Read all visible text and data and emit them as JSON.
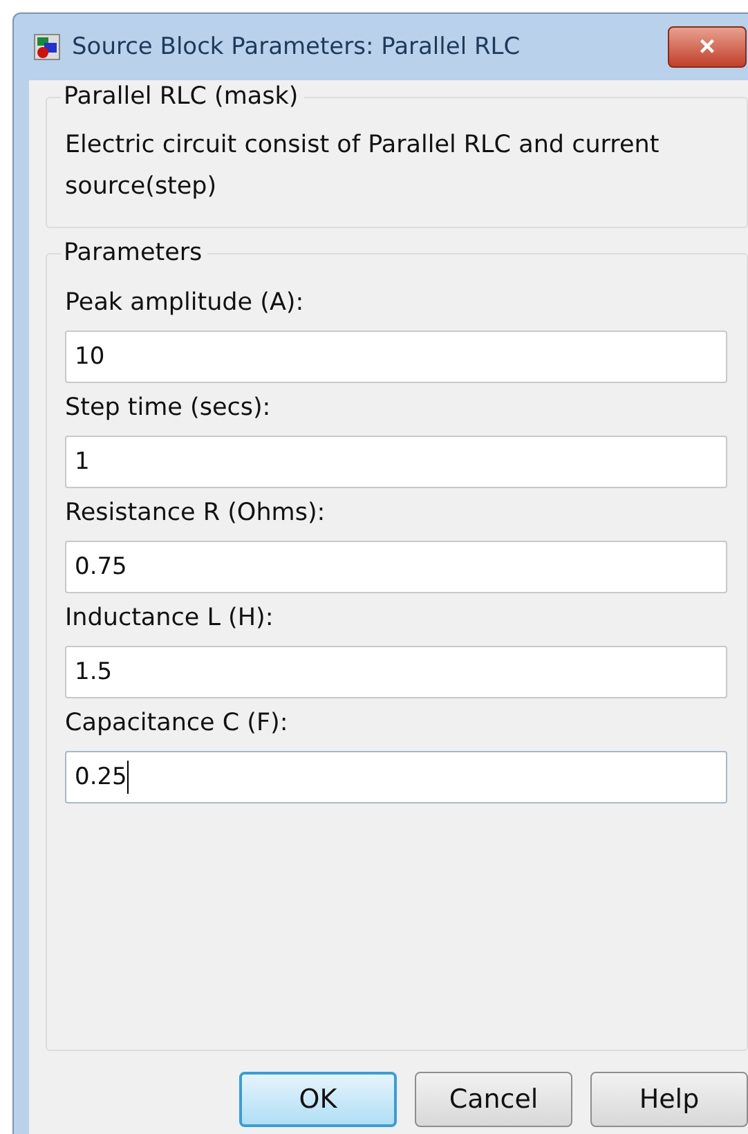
{
  "window": {
    "title": "Source Block Parameters: Parallel RLC",
    "close": "×"
  },
  "description_group": {
    "title": "Parallel RLC (mask)",
    "text": "Electric circuit consist of Parallel RLC and current source(step)"
  },
  "parameters_group": {
    "title": "Parameters",
    "fields": [
      {
        "label": "Peak amplitude (A):",
        "value": "10",
        "focused": false
      },
      {
        "label": "Step time (secs):",
        "value": "1",
        "focused": false
      },
      {
        "label": "Resistance R (Ohms):",
        "value": "0.75",
        "focused": false
      },
      {
        "label": "Inductance L (H):",
        "value": "1.5",
        "focused": false
      },
      {
        "label": "Capacitance C (F):",
        "value": "0.25",
        "focused": true
      }
    ]
  },
  "buttons": [
    {
      "label": "OK",
      "default": true
    },
    {
      "label": "Cancel",
      "default": false
    },
    {
      "label": "Help",
      "default": false
    }
  ]
}
